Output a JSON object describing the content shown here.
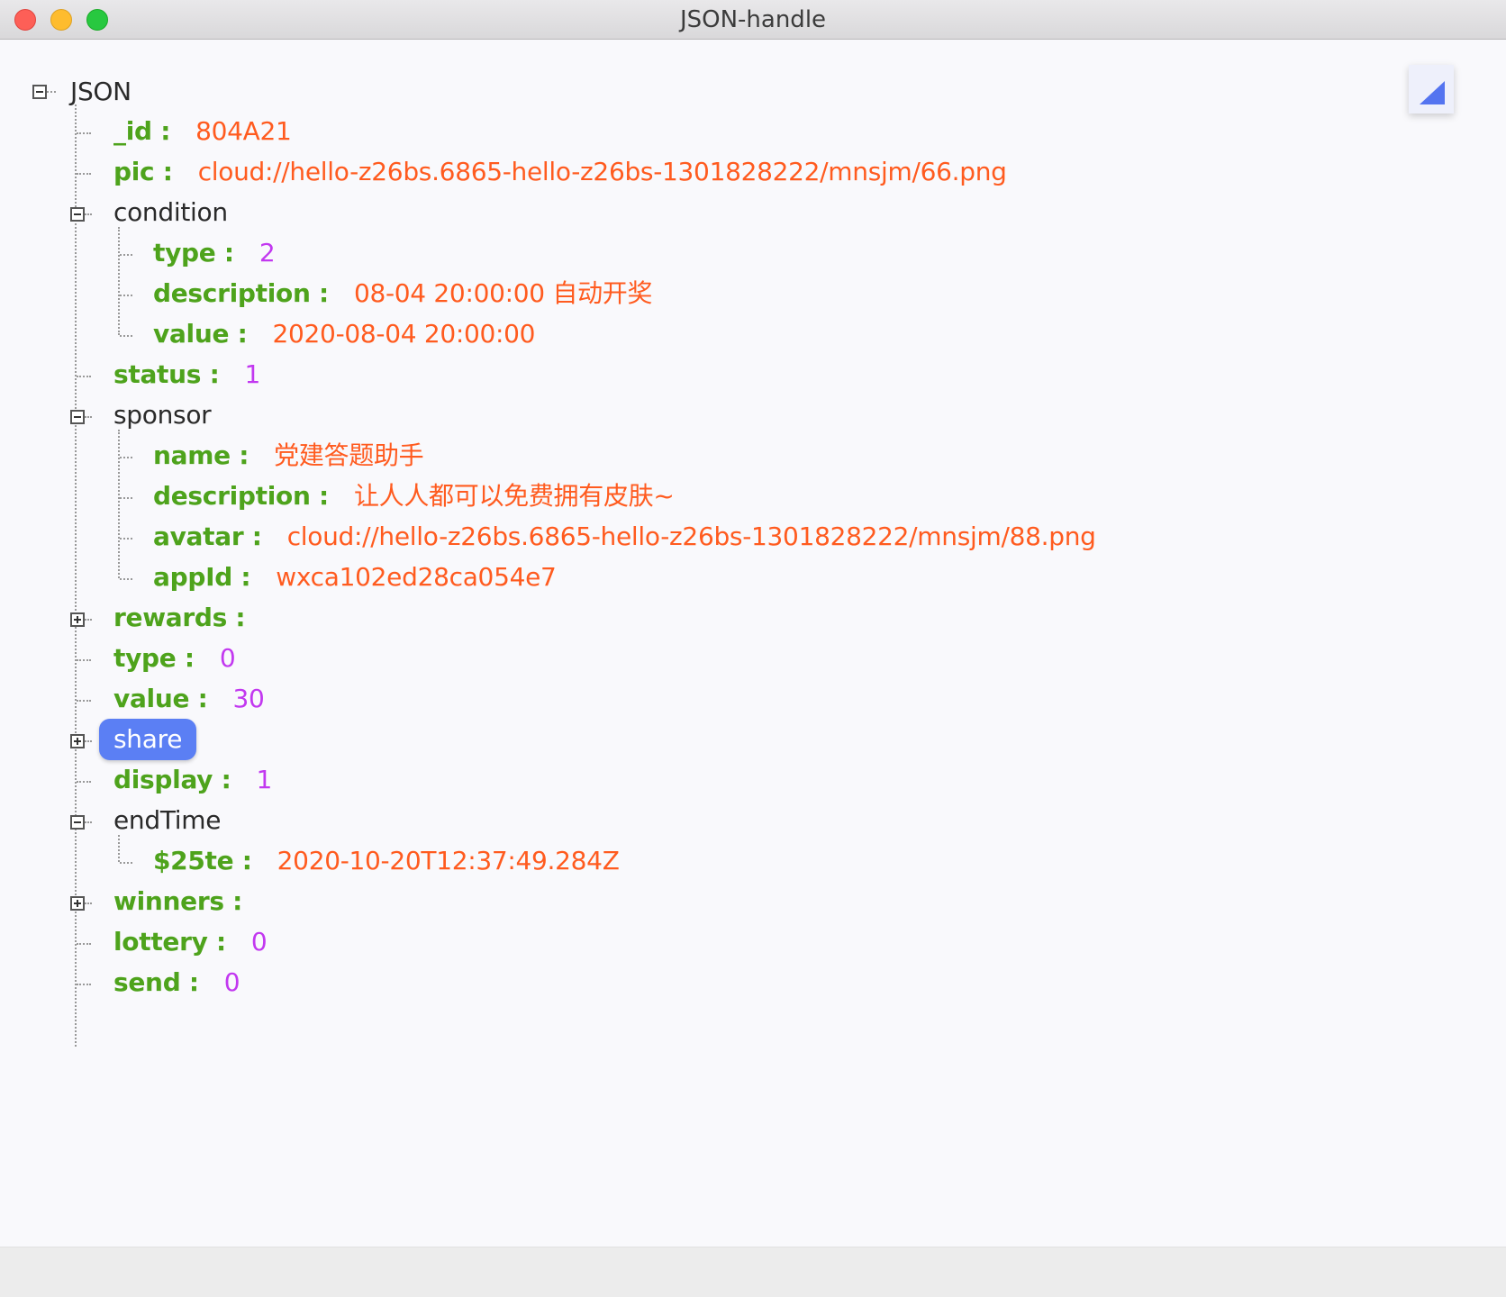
{
  "window": {
    "title": "JSON-handle"
  },
  "tree": {
    "root_label": "JSON",
    "rows": {
      "id": {
        "key": "_id :",
        "value": "804A21"
      },
      "pic": {
        "key": "pic :",
        "value": "cloud://hello-z26bs.6865-hello-z26bs-1301828222/mnsjm/66.png"
      },
      "condition": {
        "label": "condition"
      },
      "condition_type": {
        "key": "type :",
        "value": "2"
      },
      "condition_description": {
        "key": "description :",
        "value": "08-04 20:00:00 自动开奖"
      },
      "condition_value": {
        "key": "value :",
        "value": "2020-08-04 20:00:00"
      },
      "status": {
        "key": "status :",
        "value": "1"
      },
      "sponsor": {
        "label": "sponsor"
      },
      "sponsor_name": {
        "key": "name :",
        "value": "党建答题助手"
      },
      "sponsor_description": {
        "key": "description :",
        "value": "让人人都可以免费拥有皮肤~"
      },
      "sponsor_avatar": {
        "key": "avatar :",
        "value": "cloud://hello-z26bs.6865-hello-z26bs-1301828222/mnsjm/88.png"
      },
      "sponsor_appid": {
        "key": "appId :",
        "value": "wxca102ed28ca054e7"
      },
      "rewards": {
        "key": "rewards :"
      },
      "type": {
        "key": "type :",
        "value": "0"
      },
      "value": {
        "key": "value :",
        "value": "30"
      },
      "share": {
        "label": "share"
      },
      "display": {
        "key": "display :",
        "value": "1"
      },
      "endTime": {
        "label": "endTime"
      },
      "endTime_date": {
        "key": "$25te :",
        "value": "2020-10-20T12:37:49.284Z"
      },
      "winners": {
        "key": "winners :"
      },
      "lottery": {
        "key": "lottery :",
        "value": "0"
      },
      "send": {
        "key": "send :",
        "value": "0"
      }
    }
  },
  "colors": {
    "key": "#4ea31c",
    "string": "#ff5b1f",
    "number": "#c238f0",
    "selected": "#5b7ff4"
  },
  "icons": {
    "corner_button": "triangle-icon",
    "expand": "plus-box-icon",
    "collapse": "minus-box-icon"
  }
}
